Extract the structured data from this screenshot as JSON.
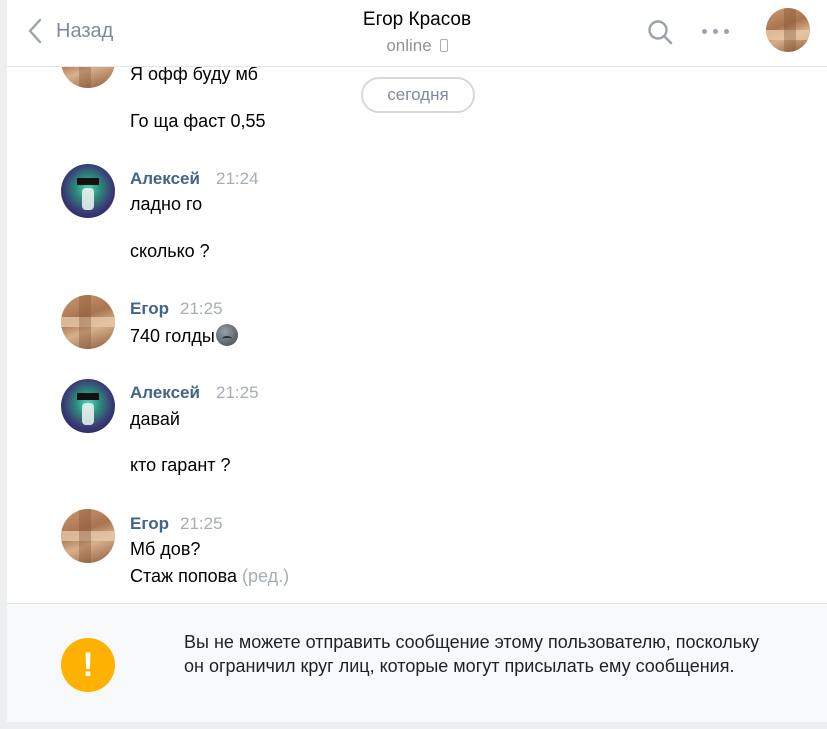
{
  "header": {
    "back_label": "Назад",
    "title": "Егор Красов",
    "status": "online",
    "icons": {
      "back": "chevron-left-icon",
      "search": "search-icon",
      "more": "more-dots-icon",
      "device": "mobile-phone-icon"
    }
  },
  "date_divider": "сегодня",
  "messages": [
    {
      "author": "",
      "time": "",
      "lines": [
        "Я офф буду мб",
        "Го ща фаст 0,55"
      ]
    },
    {
      "author": "Алексей",
      "time": "21:24",
      "lines": [
        "ладно го",
        "сколько ?"
      ]
    },
    {
      "author": "Егор",
      "time": "21:25",
      "lines": [
        "740 голды"
      ],
      "emoji": "sad-face-emoji"
    },
    {
      "author": "Алексей",
      "time": "21:25",
      "lines": [
        "давай",
        "кто гарант ?"
      ]
    },
    {
      "author": "Егор",
      "time": "21:25",
      "lines": [
        "Мб дов?",
        "Стаж попова"
      ],
      "edited_label": "(ред.)"
    }
  ],
  "notice": {
    "text": "Вы не можете отправить сообщение этому пользователю, поскольку он ограничил круг лиц, которые могут присылать ему сообщения.",
    "icon": "warning-icon",
    "icon_glyph": "!"
  },
  "colors": {
    "author": "#42648b",
    "warning": "#ffb100",
    "muted": "#a7adb5"
  }
}
